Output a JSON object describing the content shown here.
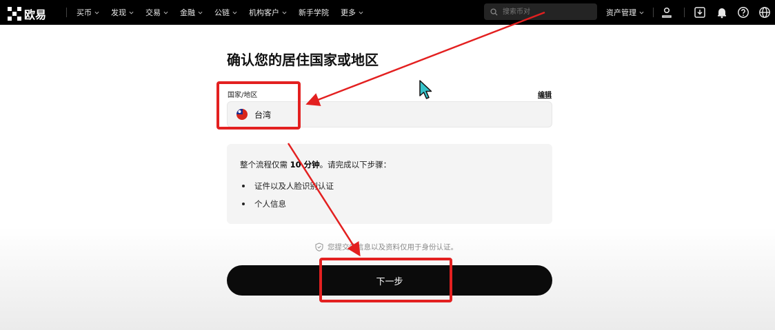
{
  "brand": {
    "name": "欧易"
  },
  "nav": {
    "items": [
      {
        "label": "买币",
        "has_dropdown": true
      },
      {
        "label": "发现",
        "has_dropdown": true
      },
      {
        "label": "交易",
        "has_dropdown": true
      },
      {
        "label": "金融",
        "has_dropdown": true
      },
      {
        "label": "公链",
        "has_dropdown": true
      },
      {
        "label": "机构客户",
        "has_dropdown": true
      },
      {
        "label": "新手学院",
        "has_dropdown": false
      },
      {
        "label": "更多",
        "has_dropdown": true
      }
    ],
    "search_placeholder": "搜索币对",
    "asset_management": "资产管理",
    "icons": [
      "user-icon",
      "download-icon",
      "bell-icon",
      "help-icon",
      "globe-icon"
    ]
  },
  "main": {
    "title": "确认您的居住国家或地区",
    "field_label": "国家/地区",
    "edit_label": "编辑",
    "country": "台湾",
    "info": {
      "intro_prefix": "整个流程仅需",
      "intro_duration": "10 分钟",
      "intro_suffix": "。请完成以下步骤：",
      "steps": [
        "证件以及人脸识别认证",
        "个人信息"
      ]
    },
    "privacy_note": "您提交的信息以及资料仅用于身份认证。",
    "next_button": "下一步"
  },
  "colors": {
    "nav_bg": "#000000",
    "button_bg": "#0b0b0b",
    "annotation_red": "#e32020",
    "cursor_teal": "#35c2c9"
  }
}
